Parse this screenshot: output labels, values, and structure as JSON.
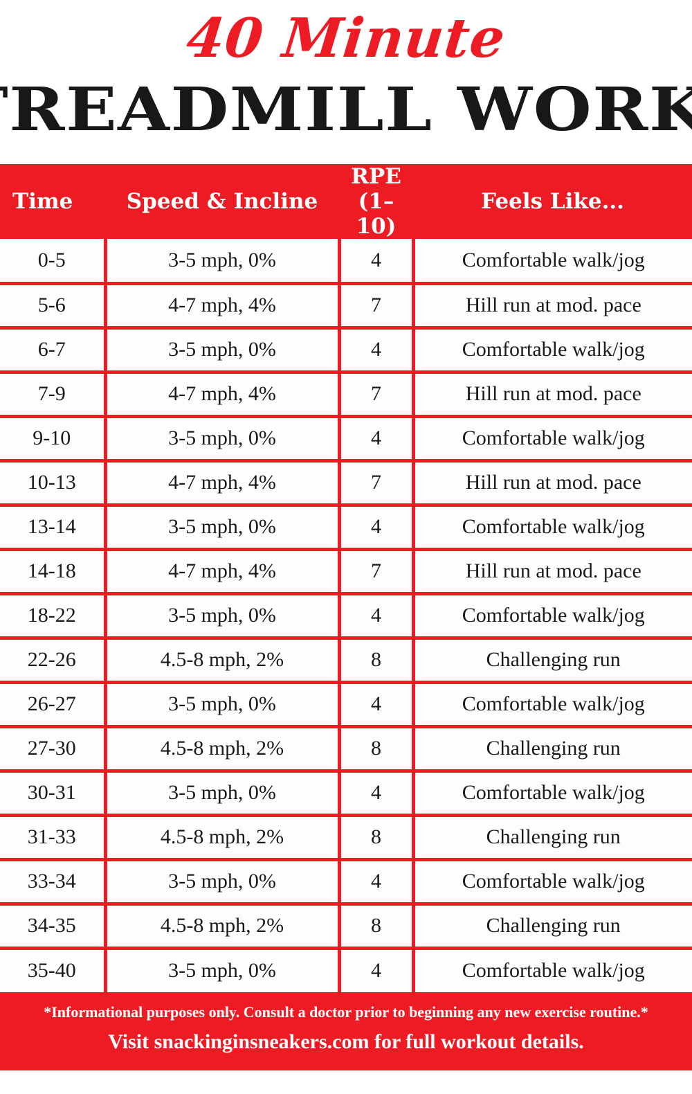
{
  "title": {
    "script_line": "40 Minute",
    "main_line": "TREADMILL WORKOUT!"
  },
  "colors": {
    "brand_red": "#ED1C24",
    "text_black": "#1a1a1a",
    "cell_background": "#fdfdfd",
    "header_text": "#ffffff"
  },
  "table": {
    "headers": {
      "time": "Time",
      "speed_incline": "Speed & Incline",
      "rpe": "RPE (1–10)",
      "feels_like": "Feels Like..."
    },
    "rows": [
      {
        "time": "0-5",
        "speed": "3-5 mph, 0%",
        "rpe": "4",
        "feels": "Comfortable walk/jog"
      },
      {
        "time": "5-6",
        "speed": "4-7 mph, 4%",
        "rpe": "7",
        "feels": "Hill run at mod. pace"
      },
      {
        "time": "6-7",
        "speed": "3-5 mph, 0%",
        "rpe": "4",
        "feels": "Comfortable walk/jog"
      },
      {
        "time": "7-9",
        "speed": "4-7 mph, 4%",
        "rpe": "7",
        "feels": "Hill run at mod. pace"
      },
      {
        "time": "9-10",
        "speed": "3-5 mph, 0%",
        "rpe": "4",
        "feels": "Comfortable walk/jog"
      },
      {
        "time": "10-13",
        "speed": "4-7 mph, 4%",
        "rpe": "7",
        "feels": "Hill run at mod. pace"
      },
      {
        "time": "13-14",
        "speed": "3-5 mph, 0%",
        "rpe": "4",
        "feels": "Comfortable walk/jog"
      },
      {
        "time": "14-18",
        "speed": "4-7 mph, 4%",
        "rpe": "7",
        "feels": "Hill run at mod. pace"
      },
      {
        "time": "18-22",
        "speed": "3-5 mph, 0%",
        "rpe": "4",
        "feels": "Comfortable walk/jog"
      },
      {
        "time": "22-26",
        "speed": "4.5-8 mph, 2%",
        "rpe": "8",
        "feels": "Challenging run"
      },
      {
        "time": "26-27",
        "speed": "3-5 mph, 0%",
        "rpe": "4",
        "feels": "Comfortable walk/jog"
      },
      {
        "time": "27-30",
        "speed": "4.5-8 mph, 2%",
        "rpe": "8",
        "feels": "Challenging run"
      },
      {
        "time": "30-31",
        "speed": "3-5 mph, 0%",
        "rpe": "4",
        "feels": "Comfortable walk/jog"
      },
      {
        "time": "31-33",
        "speed": "4.5-8 mph, 2%",
        "rpe": "8",
        "feels": "Challenging run"
      },
      {
        "time": "33-34",
        "speed": "3-5 mph, 0%",
        "rpe": "4",
        "feels": "Comfortable walk/jog"
      },
      {
        "time": "34-35",
        "speed": "4.5-8 mph, 2%",
        "rpe": "8",
        "feels": "Challenging run"
      },
      {
        "time": "35-40",
        "speed": "3-5 mph, 0%",
        "rpe": "4",
        "feels": "Comfortable walk/jog"
      }
    ]
  },
  "footer": {
    "disclaimer": "*Informational purposes only. Consult a doctor prior to beginning any new exercise routine.*",
    "visit": "Visit snackinginsneakers.com for full workout details."
  }
}
